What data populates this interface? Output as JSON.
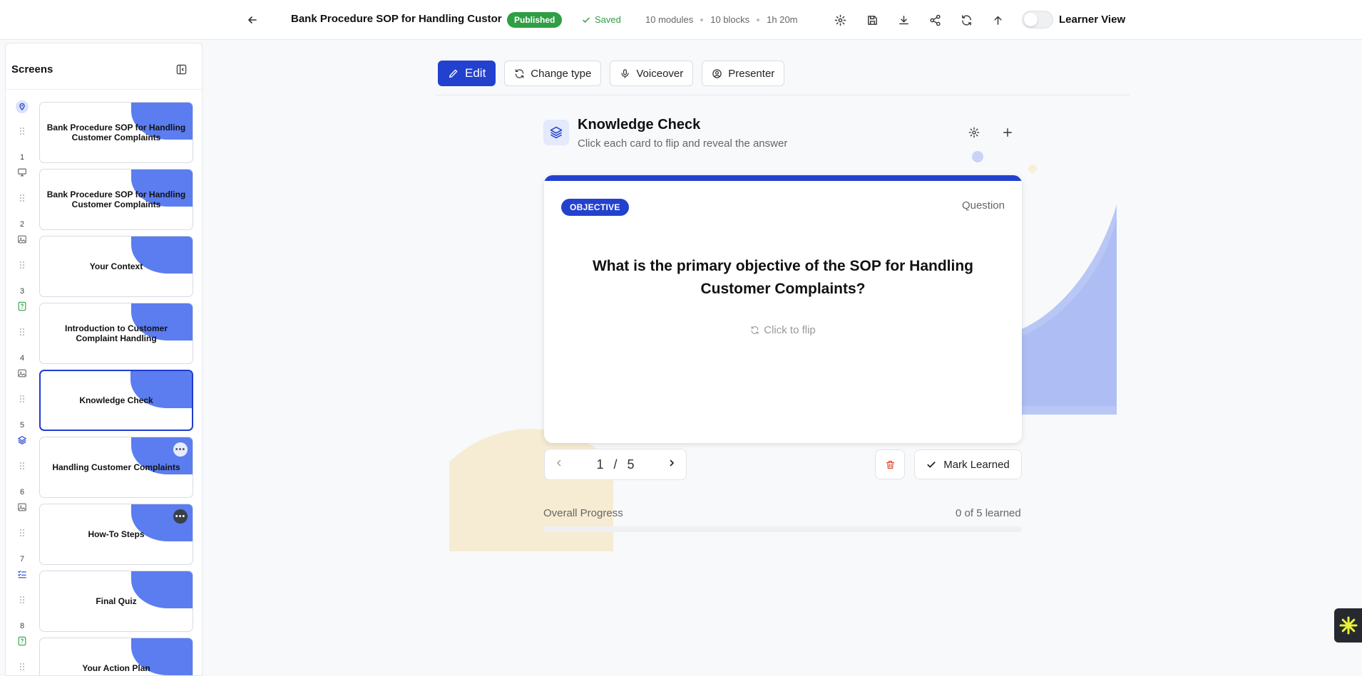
{
  "header": {
    "title": "Bank Procedure SOP for Handling Custor",
    "status_badge": "Published",
    "saved_label": "Saved",
    "modules": "10 modules",
    "blocks": "10 blocks",
    "duration": "1h 20m",
    "learner_view_label": "Learner View",
    "learner_view_on": false
  },
  "sidebar": {
    "title": "Screens",
    "screens": [
      {
        "label": "Bank Procedure SOP for Handling Customer Complaints",
        "icon": "location-pin-icon",
        "number": ""
      },
      {
        "label": "Bank Procedure SOP for Handling Customer Complaints",
        "icon": "presentation-icon",
        "number": "1"
      },
      {
        "label": "Your Context",
        "icon": "image-icon",
        "number": "2"
      },
      {
        "label": "Introduction to Customer Complaint Handling",
        "icon": "quiz-icon",
        "number": "3"
      },
      {
        "label": "Knowledge Check",
        "icon": "image-icon",
        "number": "4"
      },
      {
        "label": "Handling Customer Complaints",
        "icon": "layers-icon",
        "number": "5"
      },
      {
        "label": "How-To Steps",
        "icon": "image-icon",
        "number": "6"
      },
      {
        "label": "Final Quiz",
        "icon": "checklist-icon",
        "number": "7"
      },
      {
        "label": "Your Action Plan",
        "icon": "quiz-icon",
        "number": "8"
      }
    ]
  },
  "toolbar": {
    "edit": "Edit",
    "change_type": "Change type",
    "voiceover": "Voiceover",
    "presenter": "Presenter"
  },
  "block": {
    "title": "Knowledge Check",
    "subtitle": "Click each card to flip and reveal the answer"
  },
  "card": {
    "tag": "OBJECTIVE",
    "side_label": "Question",
    "question": "What is the primary objective of the SOP for Handling Customer Complaints?",
    "flip_hint": "Click to flip"
  },
  "pager": {
    "current": "1",
    "separator": "/",
    "total": "5"
  },
  "actions": {
    "mark_learned": "Mark Learned"
  },
  "progress": {
    "label": "Overall Progress",
    "count": "0 of 5 learned",
    "learned": 0,
    "total": 5
  },
  "colors": {
    "primary": "#2341cf",
    "success": "#2f9e44",
    "thumb_accent": "#5b7df0",
    "danger": "#e0503c"
  }
}
